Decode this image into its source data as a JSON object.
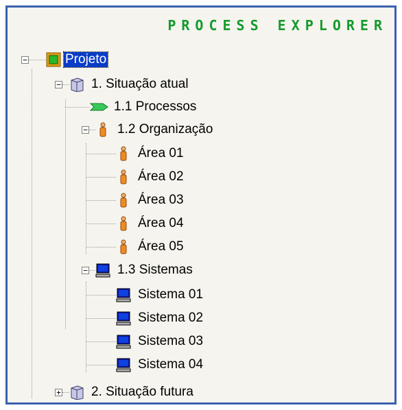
{
  "header": {
    "title": "PROCESS EXPLORER"
  },
  "tree": {
    "root": {
      "label": "Projeto",
      "icon": "project-icon",
      "expander": "−"
    },
    "situacao_atual": {
      "label": "1. Situação atual",
      "icon": "folder-icon",
      "expander": "−"
    },
    "processos": {
      "label": "1.1 Processos",
      "icon": "process-arrow-icon"
    },
    "organizacao": {
      "label": "1.2 Organização",
      "icon": "person-icon",
      "expander": "−"
    },
    "areas": [
      {
        "label": "Área 01",
        "icon": "person-icon"
      },
      {
        "label": "Área 02",
        "icon": "person-icon"
      },
      {
        "label": "Área 03",
        "icon": "person-icon"
      },
      {
        "label": "Área 04",
        "icon": "person-icon"
      },
      {
        "label": "Área 05",
        "icon": "person-icon"
      }
    ],
    "sistemas": {
      "label": "1.3 Sistemas",
      "icon": "computer-icon",
      "expander": "−"
    },
    "sistemas_items": [
      {
        "label": "Sistema 01",
        "icon": "computer-icon"
      },
      {
        "label": "Sistema 02",
        "icon": "computer-icon"
      },
      {
        "label": "Sistema 03",
        "icon": "computer-icon"
      },
      {
        "label": "Sistema 04",
        "icon": "computer-icon"
      }
    ],
    "situacao_futura": {
      "label": "2. Situação futura",
      "icon": "folder-icon",
      "expander": "+"
    }
  },
  "colors": {
    "title": "#149a2c",
    "border": "#3a5fae",
    "selection": "#0a3cc8",
    "panel_bg": "#f5f4ee"
  }
}
